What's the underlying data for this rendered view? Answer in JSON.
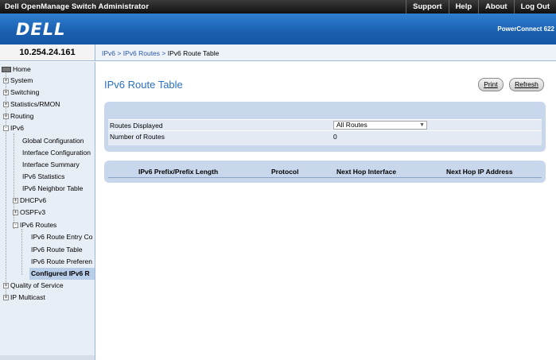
{
  "window": {
    "app_title": "Dell OpenManage Switch Administrator",
    "links": [
      "Support",
      "Help",
      "About",
      "Log Out"
    ]
  },
  "banner": {
    "logo_text": "DELL",
    "product": "PowerConnect 622"
  },
  "ip_address": "10.254.24.161",
  "breadcrumb": {
    "items": [
      "IPv6",
      "IPv6 Routes"
    ],
    "separator": ">",
    "current": "IPv6 Route Table"
  },
  "nav": {
    "items": [
      {
        "label": "Home",
        "icon": "home-icon"
      },
      {
        "label": "System",
        "toggle": "+"
      },
      {
        "label": "Switching",
        "toggle": "+"
      },
      {
        "label": "Statistics/RMON",
        "toggle": "+"
      },
      {
        "label": "Routing",
        "toggle": "+"
      },
      {
        "label": "IPv6",
        "toggle": "-"
      },
      {
        "label": "Global Configuration"
      },
      {
        "label": "Interface Configuration"
      },
      {
        "label": "Interface Summary"
      },
      {
        "label": "IPv6 Statistics"
      },
      {
        "label": "IPv6 Neighbor Table"
      },
      {
        "label": "DHCPv6",
        "toggle": "+"
      },
      {
        "label": "OSPFv3",
        "toggle": "+"
      },
      {
        "label": "IPv6 Routes",
        "toggle": "-"
      },
      {
        "label": "IPv6 Route Entry Co"
      },
      {
        "label": "IPv6 Route Table"
      },
      {
        "label": "IPv6 Route Preferen"
      },
      {
        "label": "Configured IPv6 R",
        "selected": true
      },
      {
        "label": "Quality of Service",
        "toggle": "+"
      },
      {
        "label": "IP Multicast",
        "toggle": "+"
      }
    ]
  },
  "page": {
    "title": "IPv6 Route Table",
    "print_label": "Print",
    "refresh_label": "Refresh"
  },
  "summary": {
    "routes_displayed_label": "Routes Displayed",
    "routes_displayed_value": "All Routes",
    "number_of_routes_label": "Number of Routes",
    "number_of_routes_value": "0"
  },
  "table": {
    "columns": [
      "IPv6 Prefix/Prefix Length",
      "Protocol",
      "Next Hop Interface",
      "Next Hop IP Address"
    ]
  },
  "colors": {
    "banner_blue": "#1a5fb0",
    "title_blue": "#2a6fc0",
    "panel_blue": "#c9d7ec"
  }
}
